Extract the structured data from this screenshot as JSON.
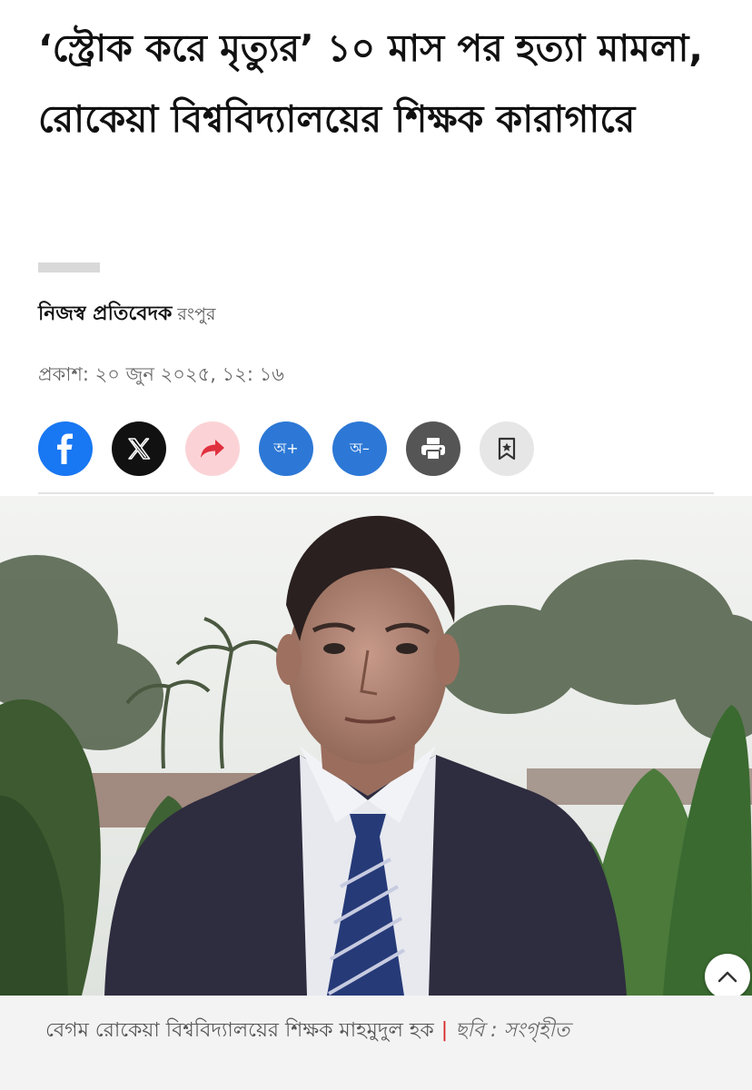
{
  "article": {
    "headline": "‘স্ট্রোক করে মৃত্যুর’ ১০ মাস পর হত্যা মামলা, রোকেয়া বিশ্ববিদ্যালয়ের শিক্ষক কারাগারে",
    "author": "নিজস্ব প্রতিবেদক",
    "location": "রংপুর",
    "published": "প্রকাশ: ২০ জুন ২০২৫, ১২: ১৬"
  },
  "share": {
    "font_up_label": "অ+",
    "font_down_label": "অ–",
    "icons": [
      "facebook-icon",
      "x-icon",
      "share-arrow-icon",
      "font-increase",
      "font-decrease",
      "printer-icon",
      "bookmark-star-icon"
    ]
  },
  "photo": {
    "caption": "বেগম রোকেয়া বিশ্ববিদ্যালয়ের শিক্ষক মাহমুদুল হক",
    "separator": "|",
    "credit": "ছবি : সংগৃহীত"
  },
  "colors": {
    "facebook": "#1877f2",
    "x": "#111111",
    "share": "#fbd3d6",
    "font_buttons": "#2d78d6",
    "print": "#555555",
    "bookmark": "#e6e6e6",
    "caption_separator": "#d62828"
  }
}
